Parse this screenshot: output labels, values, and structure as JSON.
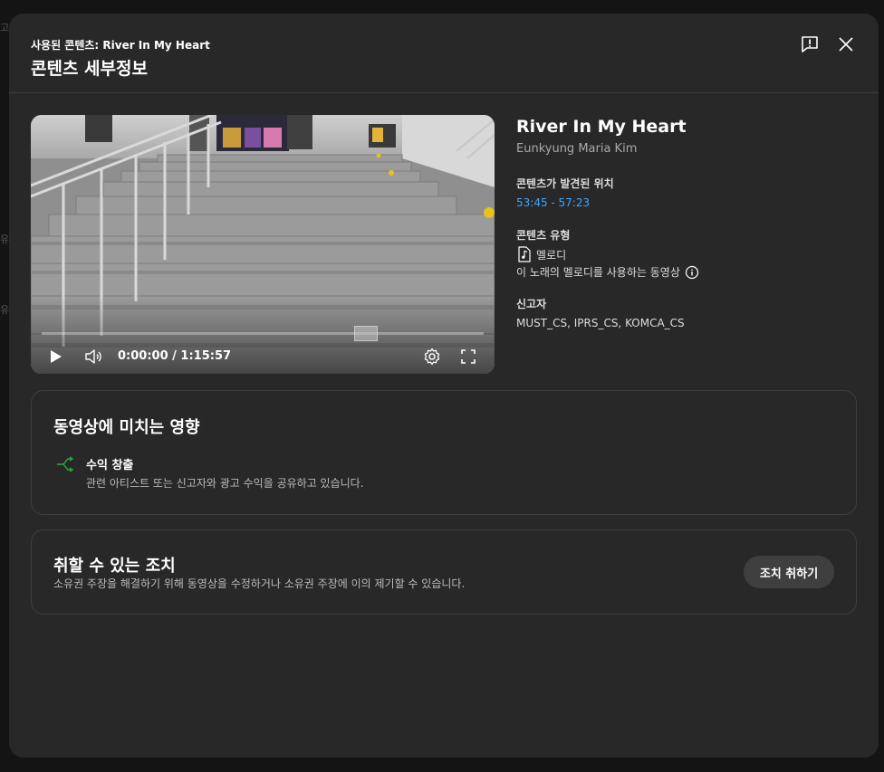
{
  "background": {
    "edge_texts": [
      "고지",
      "유",
      "유"
    ]
  },
  "header": {
    "subtitle": "사용된 콘텐츠: River In My Heart",
    "title": "콘텐츠 세부정보"
  },
  "video": {
    "time": "0:00:00 / 1:15:57",
    "progress_fraction": 0.0
  },
  "info": {
    "song_title": "River In My Heart",
    "artist": "Eunkyung Maria Kim",
    "location_label": "콘텐츠가 발견된 위치",
    "location_value": "53:45 - 57:23",
    "type_label": "콘텐츠 유형",
    "type_value": "멜로디",
    "type_desc": "이 노래의 멜로디를 사용하는 동영상",
    "claimant_label": "신고자",
    "claimant_value": "MUST_CS, IPRS_CS, KOMCA_CS"
  },
  "impact": {
    "title": "동영상에 미치는 영향",
    "item_title": "수익 창출",
    "item_desc": "관련 아티스트 또는 신고자와 광고 수익을 공유하고 있습니다."
  },
  "actions": {
    "title": "취할 수 있는 조치",
    "desc": "소유권 주장을 해결하기 위해 동영상을 수정하거나 소유권 주장에 이의 제기할 수 있습니다.",
    "button_label": "조치 취하기"
  },
  "colors": {
    "link": "#3ea6ff",
    "monetize_icon": "#2ba640",
    "modal_bg": "#282828"
  },
  "icons": [
    "report-icon",
    "close-icon",
    "play-icon",
    "volume-icon",
    "settings-icon",
    "fullscreen-icon",
    "music-note-icon",
    "info-icon",
    "monetize-icon"
  ]
}
